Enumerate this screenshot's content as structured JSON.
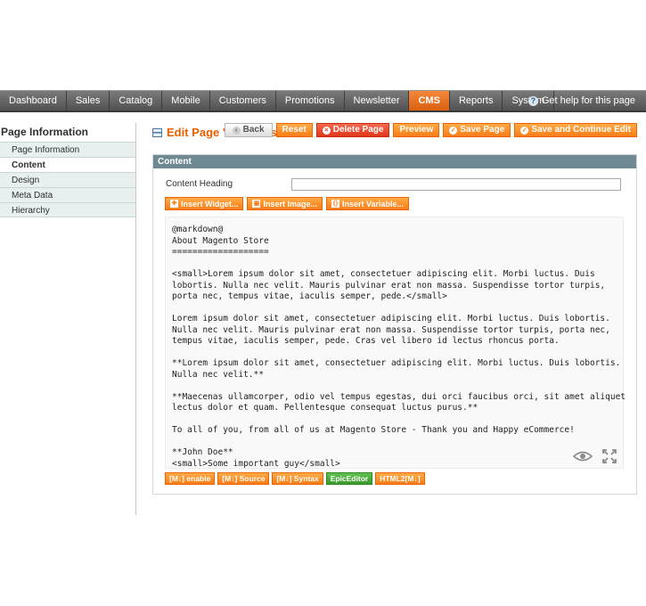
{
  "nav": {
    "items": [
      "Dashboard",
      "Sales",
      "Catalog",
      "Mobile",
      "Customers",
      "Promotions",
      "Newsletter",
      "CMS",
      "Reports",
      "System"
    ],
    "active": "CMS",
    "help": "Get help for this page"
  },
  "sidebar": {
    "title": "Page Information",
    "items": [
      {
        "label": "Page Information",
        "active": false
      },
      {
        "label": "Content",
        "active": true
      },
      {
        "label": "Design",
        "active": false
      },
      {
        "label": "Meta Data",
        "active": false
      },
      {
        "label": "Hierarchy",
        "active": false
      }
    ]
  },
  "header": {
    "title": "Edit Page 'About Us'",
    "buttons": {
      "back": "Back",
      "reset": "Reset",
      "delete": "Delete Page",
      "preview": "Preview",
      "save": "Save Page",
      "save_continue": "Save and Continue Edit"
    }
  },
  "content": {
    "panel_title": "Content",
    "heading_label": "Content Heading",
    "heading_value": "",
    "insert_buttons": {
      "widget": "Insert Widget...",
      "image": "Insert Image...",
      "variable": "Insert Variable..."
    },
    "editor_text": "@markdown@\nAbout Magento Store\n===================\n\n<small>Lorem ipsum dolor sit amet, consectetuer adipiscing elit. Morbi luctus. Duis\nlobortis. Nulla nec velit. Mauris pulvinar erat non massa. Suspendisse tortor turpis,\nporta nec, tempus vitae, iaculis semper, pede.</small>\n\nLorem ipsum dolor sit amet, consectetuer adipiscing elit. Morbi luctus. Duis lobortis.\nNulla nec velit. Mauris pulvinar erat non massa. Suspendisse tortor turpis, porta nec,\ntempus vitae, iaculis semper, pede. Cras vel libero id lectus rhoncus porta.\n\n**Lorem ipsum dolor sit amet, consectetuer adipiscing elit. Morbi luctus. Duis lobortis.\nNulla nec velit.**\n\n**Maecenas ullamcorper, odio vel tempus egestas, dui orci faucibus orci, sit amet aliquet\nlectus dolor et quam. Pellentesque consequat luctus purus.**\n\nTo all of you, from all of us at Magento Store - Thank you and Happy eCommerce!\n\n**John Doe**\n<small>Some important guy</small>",
    "md_buttons": {
      "enable": "[M↓] enable",
      "source": "[M↓] Source",
      "syntax": "[M↓] Syntax",
      "epic": "EpicEditor",
      "html2md": "HTML2[M↓]"
    }
  }
}
